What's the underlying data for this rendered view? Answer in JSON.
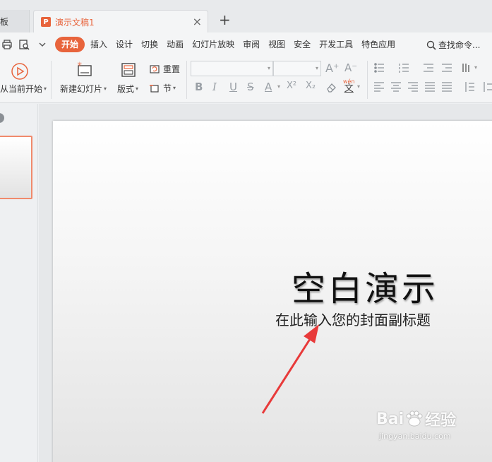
{
  "tabs": {
    "previous_label": "板",
    "active_label": "演示文稿1",
    "logo_letter": "P",
    "close_glyph": "×",
    "add_glyph": "+"
  },
  "menu": {
    "items": [
      "开始",
      "插入",
      "设计",
      "切换",
      "动画",
      "幻灯片放映",
      "审阅",
      "视图",
      "安全",
      "开发工具",
      "特色应用"
    ],
    "active_index": 0,
    "search_label": "查找命令..."
  },
  "ribbon": {
    "play_from_current": "从当前开始",
    "new_slide": "新建幻灯片",
    "layout": "版式",
    "reset": "重置",
    "section": "节",
    "font_buttons": [
      "B",
      "I",
      "U",
      "S",
      "A",
      "X²",
      "X₂"
    ],
    "font_size_up": "A⁺",
    "font_size_down": "A⁻",
    "pinyin_label": "wén",
    "pinyin_char": "文"
  },
  "slide": {
    "title": "空白演示",
    "subtitle": "在此输入您的封面副标题"
  },
  "watermark": {
    "brand": "Bai",
    "brand_tail": "经验",
    "url": "jingyan.baidu.com"
  },
  "colors": {
    "accent": "#e8643c",
    "arrow": "#e83a3a"
  }
}
